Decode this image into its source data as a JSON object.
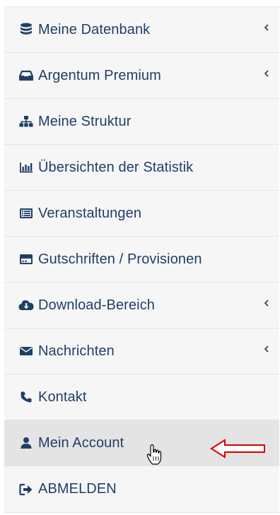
{
  "menu": {
    "items": [
      {
        "label": "Meine Datenbank",
        "icon": "database-icon",
        "has_submenu": true
      },
      {
        "label": "Argentum Premium",
        "icon": "inbox-icon",
        "has_submenu": true
      },
      {
        "label": "Meine Struktur",
        "icon": "sitemap-icon",
        "has_submenu": false
      },
      {
        "label": "Übersichten der Statistik",
        "icon": "bar-chart-icon",
        "has_submenu": false
      },
      {
        "label": "Veranstaltungen",
        "icon": "list-alt-icon",
        "has_submenu": false
      },
      {
        "label": "Gutschriften / Provisionen",
        "icon": "credit-card-icon",
        "has_submenu": false
      },
      {
        "label": "Download-Bereich",
        "icon": "cloud-download-icon",
        "has_submenu": true
      },
      {
        "label": "Nachrichten",
        "icon": "envelope-icon",
        "has_submenu": true
      },
      {
        "label": "Kontakt",
        "icon": "phone-icon",
        "has_submenu": false
      },
      {
        "label": "Mein Account",
        "icon": "user-icon",
        "has_submenu": false,
        "active": true
      },
      {
        "label": "ABMELDEN",
        "icon": "sign-out-icon",
        "has_submenu": false
      }
    ]
  },
  "colors": {
    "text": "#1f3f66",
    "background": "#f6f6f6",
    "active_background": "#e4e4e4",
    "annotation_arrow": "#d40000"
  },
  "annotations": {
    "pointer": "hand-cursor-icon",
    "arrow": "red-outline-arrow-left-icon"
  }
}
